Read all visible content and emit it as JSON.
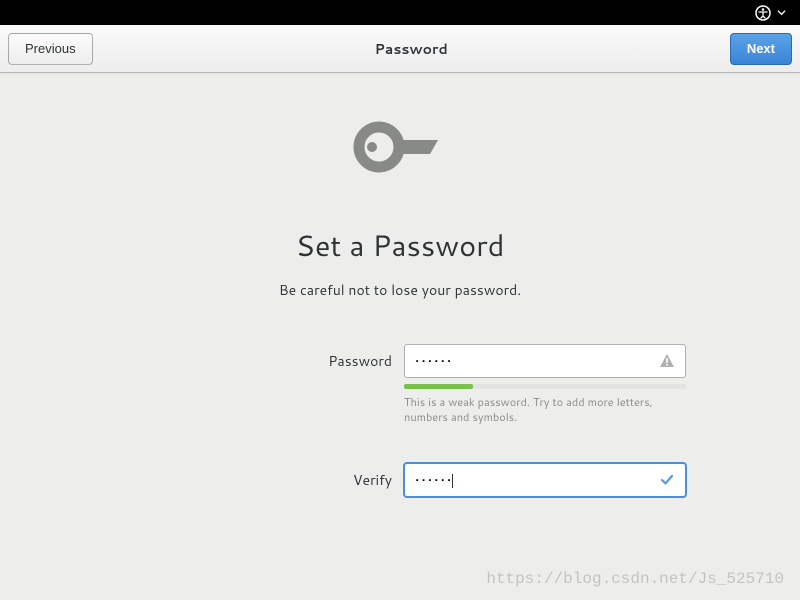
{
  "header": {
    "title": "Password",
    "previous": "Previous",
    "next": "Next"
  },
  "page": {
    "title": "Set a Password",
    "subtitle": "Be careful not to lose your password."
  },
  "form": {
    "password_label": "Password",
    "password_value": "••••••",
    "verify_label": "Verify",
    "verify_value": "••••••",
    "hint": "This is a weak password. Try to add more letters, numbers and symbols."
  },
  "watermark": "https://blog.csdn.net/Js_525710"
}
